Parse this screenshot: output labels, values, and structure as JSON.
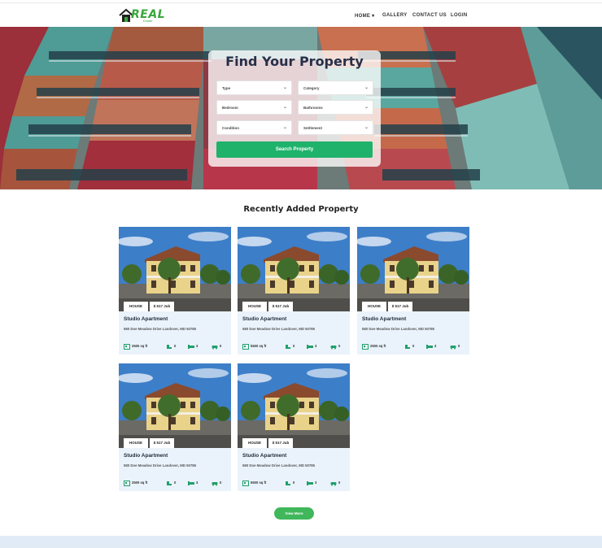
{
  "brand": {
    "logo_text": "REAL",
    "logo_sub": "Estate",
    "accent": "#3aa63c"
  },
  "nav": {
    "items": [
      {
        "label": "HOME",
        "has_dropdown": true
      },
      {
        "label": "GALLERY"
      },
      {
        "label": "CONTACT US"
      },
      {
        "label": "LOGIN"
      }
    ]
  },
  "search": {
    "title": "Find Your Property",
    "fields": [
      {
        "label": "Type"
      },
      {
        "label": "Category"
      },
      {
        "label": "Bedroom"
      },
      {
        "label": "Bathrooms"
      },
      {
        "label": "Condition"
      },
      {
        "label": "Settlement"
      }
    ],
    "button_label": "Search Property",
    "button_color": "#1fb26b"
  },
  "recent": {
    "title": "Recently Added Property",
    "cards": [
      {
        "type": "HOUSE",
        "price": "$ 517 Jub",
        "title": "Studio Apartment",
        "address": "580 Doe Meadow Drive Landover, MD 50785",
        "area": "2500 sq ft",
        "bedrooms": "0",
        "beds": "3",
        "garage": "0"
      },
      {
        "type": "HOUSE",
        "price": "$ 517 Jub",
        "title": "Studio Apartment",
        "address": "580 Doe Meadow Drive Landover, MD 50785",
        "area": "5500 sq ft",
        "bedrooms": "0",
        "beds": "3",
        "garage": "0"
      },
      {
        "type": "HOUSE",
        "price": "$ 517 Jub",
        "title": "Studio Apartment",
        "address": "580 Doe Meadow Drive Landover, MD 50785",
        "area": "2500 sq ft",
        "bedrooms": "0",
        "beds": "3",
        "garage": "0"
      },
      {
        "type": "HOUSE",
        "price": "$ 517 Jub",
        "title": "Studio Apartment",
        "address": "580 Doe Meadow Drive Landover, MD 50785",
        "area": "2500 sq ft",
        "bedrooms": "0",
        "beds": "3",
        "garage": "0"
      },
      {
        "type": "HOUSE",
        "price": "$ 517 Jub",
        "title": "Studio Apartment",
        "address": "580 Doe Meadow Drive Landover, MD 50785",
        "area": "5500 sq ft",
        "bedrooms": "0",
        "beds": "3",
        "garage": "0"
      }
    ],
    "view_more_label": "View More",
    "view_more_color": "#3fb75a"
  }
}
